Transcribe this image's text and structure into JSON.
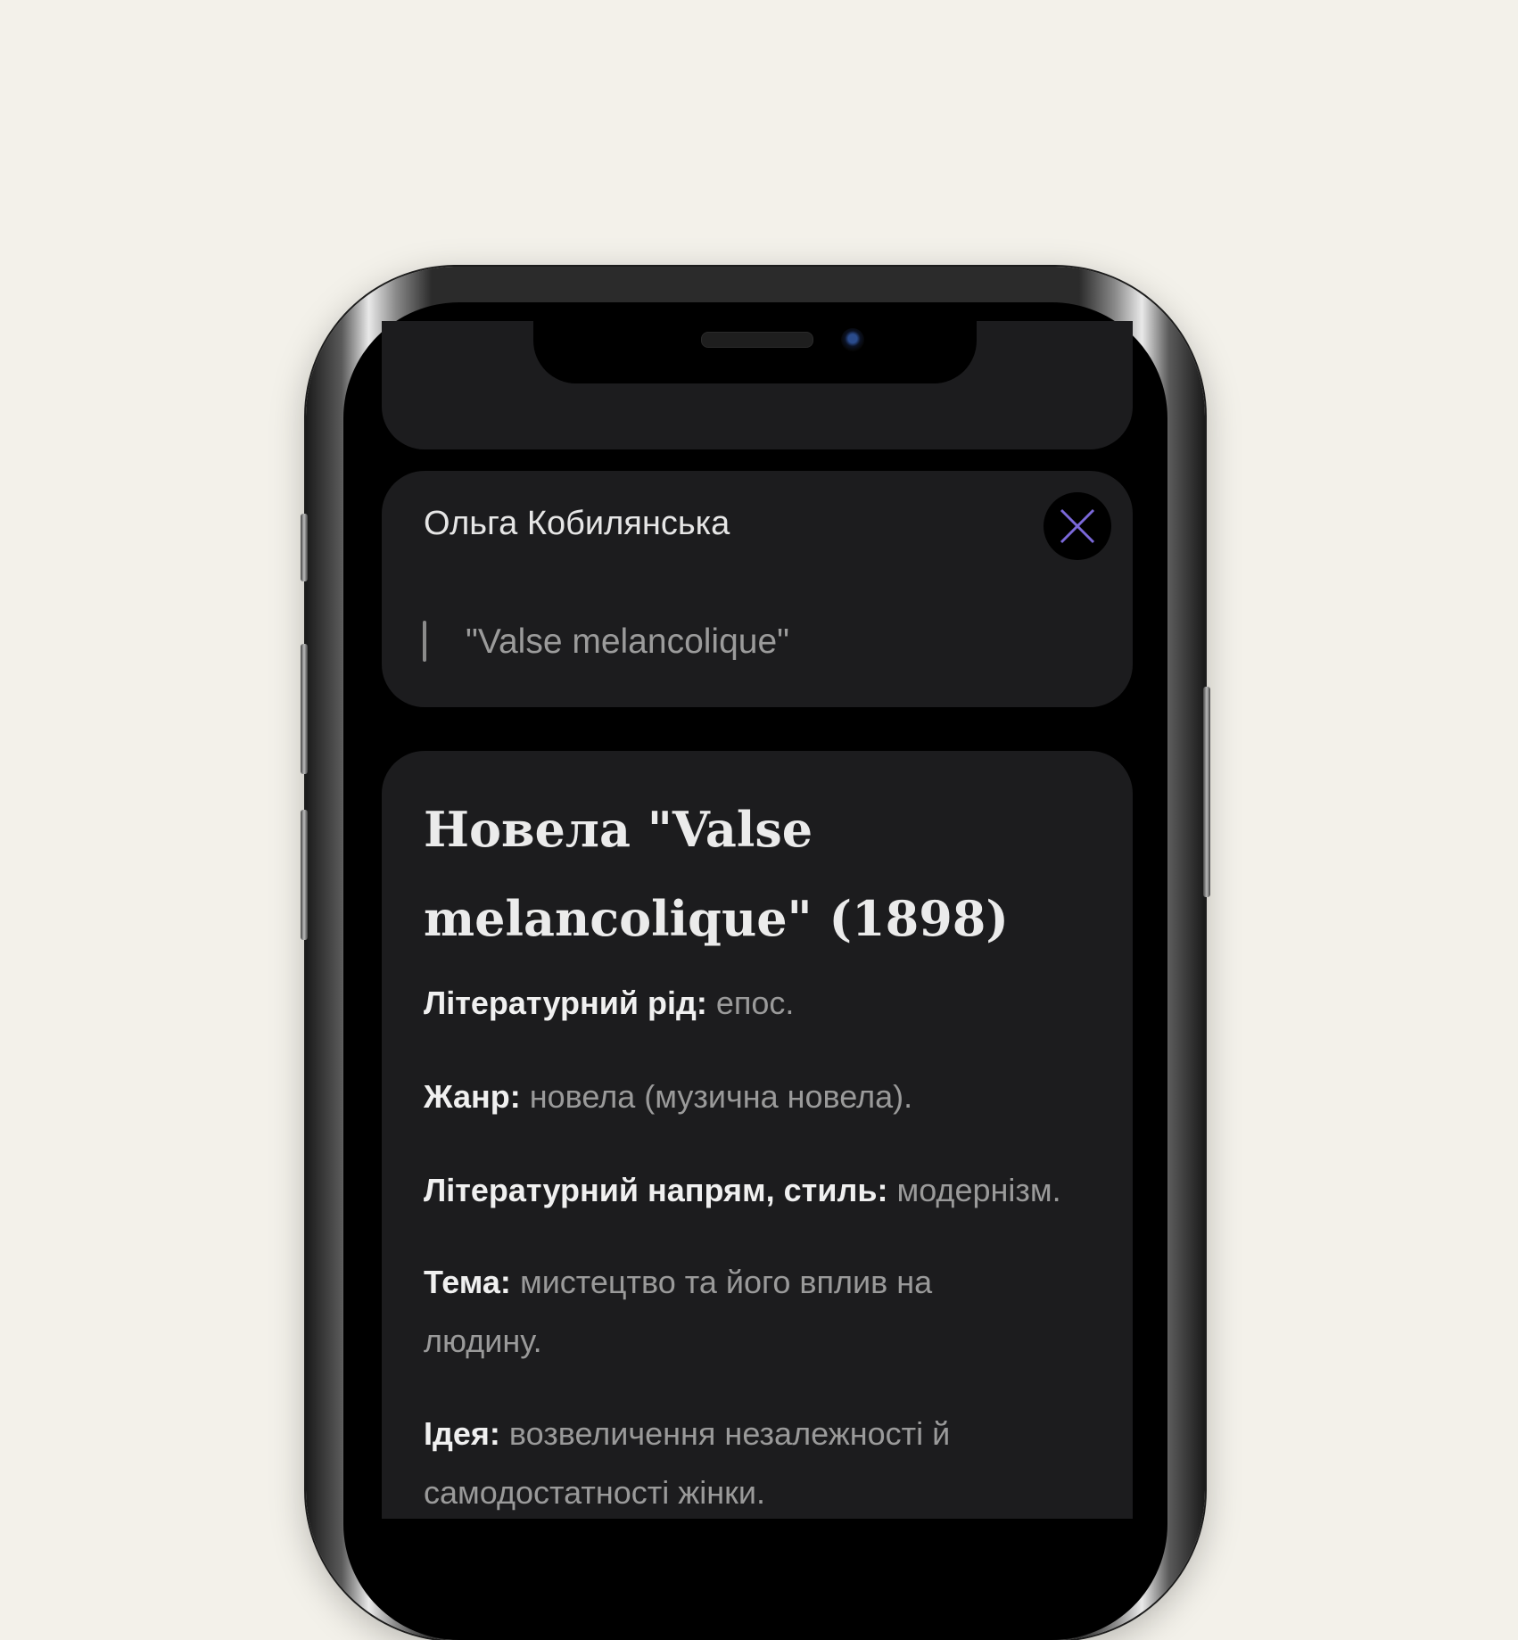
{
  "author": {
    "name": "Ольга Кобилянська",
    "quote": "\"Valse melancolique\""
  },
  "work": {
    "title": "Новела \"Valse melancolique\" (1898)",
    "fields": [
      {
        "label": "Літературний рід:",
        "value": "епос."
      },
      {
        "label": "Жанр:",
        "value": "новела (музична новела)."
      },
      {
        "label": "Літературний напрям, стиль:",
        "value": "модернізм."
      },
      {
        "label": "Тема:",
        "value": "мистецтво та його вплив на людину."
      },
      {
        "label": "Ідея:",
        "value": "возвеличення незалежності й самодостатності жінки."
      }
    ]
  },
  "colors": {
    "background": "#f3f1ea",
    "card": "#1c1c1e",
    "accent": "#7b68d9"
  },
  "icons": {
    "close": "close-icon"
  }
}
